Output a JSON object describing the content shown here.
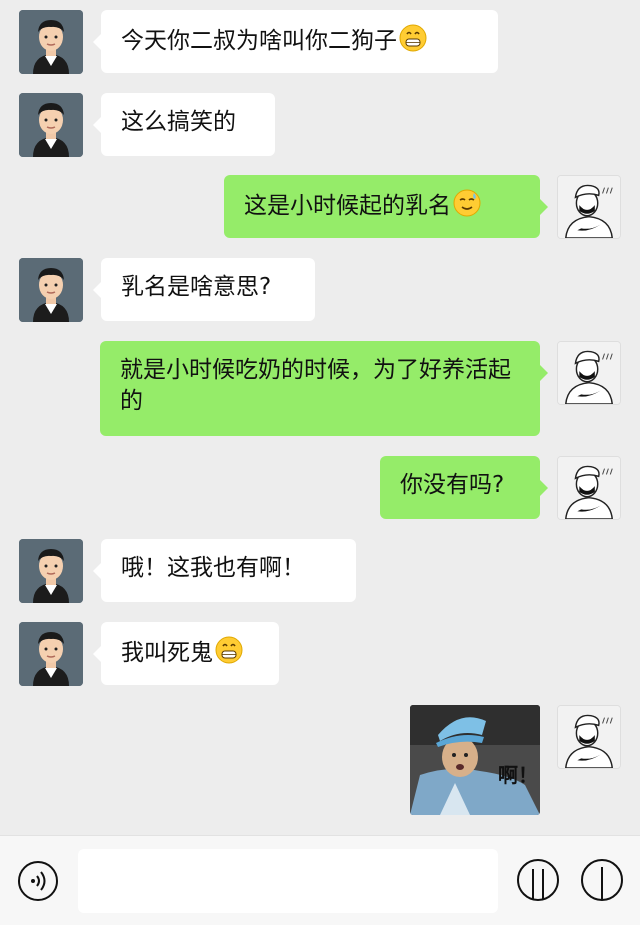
{
  "messages": [
    {
      "side": "left",
      "text": "今天你二叔为啥叫你二狗子",
      "emoji": "grin-emoji"
    },
    {
      "side": "left",
      "text": "这么搞笑的"
    },
    {
      "side": "right",
      "text": "这是小时候起的乳名",
      "emoji": "sweat-smile-emoji"
    },
    {
      "side": "left",
      "text": "乳名是啥意思?"
    },
    {
      "side": "right",
      "text": "就是小时候吃奶的时候，为了好养活起的"
    },
    {
      "side": "right",
      "text": "你没有吗?"
    },
    {
      "side": "left",
      "text": "哦！这我也有啊！"
    },
    {
      "side": "left",
      "text": "我叫死鬼",
      "emoji": "grin-emoji"
    },
    {
      "side": "right",
      "sticker": true,
      "sticker_text": "啊！"
    }
  ],
  "input": {
    "placeholder": "",
    "value": ""
  },
  "icons": {
    "voice": "voice-icon",
    "emoji": "emoji-icon",
    "more": "more-icon"
  },
  "colors": {
    "background": "#ededed",
    "bubble_self": "#95ec69",
    "bubble_other": "#ffffff"
  }
}
